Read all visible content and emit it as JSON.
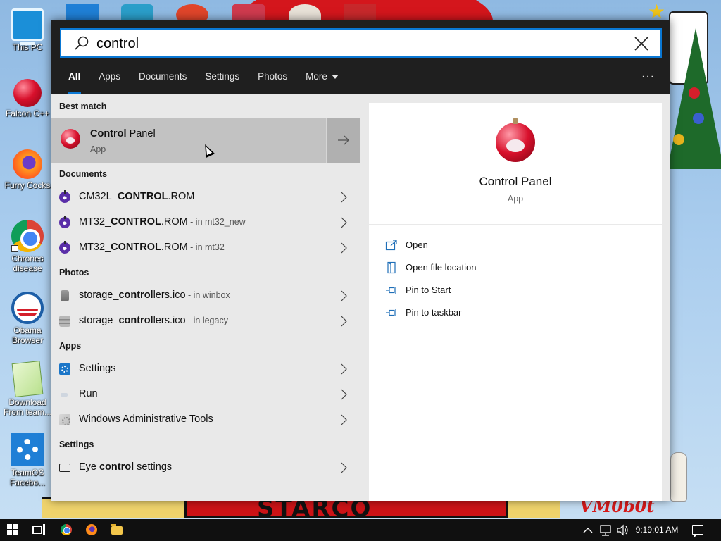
{
  "desktop": {
    "icons": [
      {
        "label": "This PC",
        "icon": "monitor-icon"
      },
      {
        "label": "Falcon C++",
        "icon": "ornament-icon"
      },
      {
        "label": "Furry Cocks",
        "icon": "firefox-icon"
      },
      {
        "label": "Chrones disease",
        "icon": "chrome-icon"
      },
      {
        "label": "Obama Browser",
        "icon": "obama-logo-icon"
      },
      {
        "label": "Download From team...",
        "icon": "notepad-icon"
      },
      {
        "label": "TeamOS Facebo...",
        "icon": "gear-icon"
      }
    ],
    "wallpaper_text": [
      "STARCO",
      "VM0b0t"
    ]
  },
  "search": {
    "query": "control",
    "clear_icon": "close-icon"
  },
  "tabs": [
    {
      "label": "All",
      "active": true
    },
    {
      "label": "Apps"
    },
    {
      "label": "Documents"
    },
    {
      "label": "Settings"
    },
    {
      "label": "Photos"
    },
    {
      "label": "More"
    }
  ],
  "more_options": "···",
  "results": {
    "best_match_header": "Best match",
    "best_match": {
      "name_bold": "Control",
      "name_rest": " Panel",
      "type": "App"
    },
    "groups": [
      {
        "header": "Documents",
        "items": [
          {
            "pre": "CM32L_",
            "bold": "CONTROL",
            "post": ".ROM",
            "loc": ""
          },
          {
            "pre": "MT32_",
            "bold": "CONTROL",
            "post": ".ROM",
            "loc": " - in mt32_new"
          },
          {
            "pre": "MT32_",
            "bold": "CONTROL",
            "post": ".ROM",
            "loc": " - in mt32"
          }
        ]
      },
      {
        "header": "Photos",
        "items": [
          {
            "pre": "storage_",
            "bold": "control",
            "post": "lers.ico",
            "loc": " - in winbox"
          },
          {
            "pre": "storage_",
            "bold": "control",
            "post": "lers.ico",
            "loc": " - in legacy"
          }
        ]
      },
      {
        "header": "Apps",
        "items": [
          {
            "pre": "Settings",
            "bold": "",
            "post": "",
            "loc": ""
          },
          {
            "pre": "Run",
            "bold": "",
            "post": "",
            "loc": ""
          },
          {
            "pre": "Windows Administrative Tools",
            "bold": "",
            "post": "",
            "loc": ""
          }
        ]
      },
      {
        "header": "Settings",
        "items": [
          {
            "pre": "Eye ",
            "bold": "control",
            "post": " settings",
            "loc": ""
          }
        ]
      }
    ]
  },
  "detail": {
    "name": "Control Panel",
    "type": "App",
    "actions": [
      {
        "label": "Open",
        "icon": "open-icon"
      },
      {
        "label": "Open file location",
        "icon": "file-location-icon"
      },
      {
        "label": "Pin to Start",
        "icon": "pin-icon"
      },
      {
        "label": "Pin to taskbar",
        "icon": "pin-icon"
      }
    ]
  },
  "taskbar": {
    "clock": "9:19:01 AM"
  },
  "colors": {
    "accent": "#0a78d4",
    "panel_dark": "#1f1f1f",
    "list_bg": "#e9e9e9",
    "selected": "#c2c2c2"
  }
}
